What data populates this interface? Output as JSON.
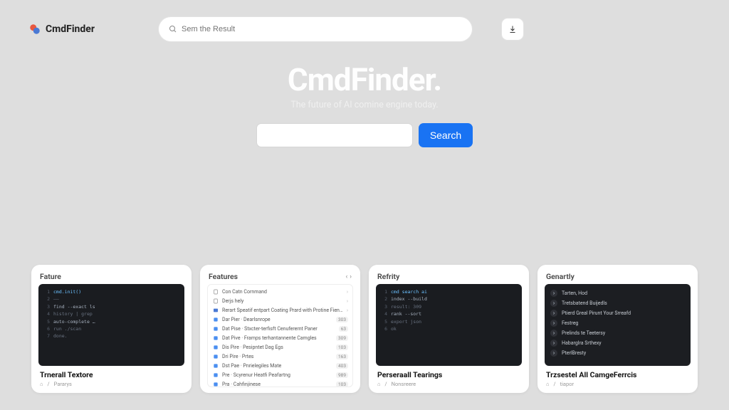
{
  "brand": "CmdFinder",
  "header": {
    "search_placeholder": "Sem the Result"
  },
  "hero": {
    "title": "CmdFinder",
    "dot": ".",
    "subtitle": "The future of AI comine engine today.",
    "search_label": "Search"
  },
  "cards": [
    {
      "head": "Fature",
      "caption": "Trnerall Textore",
      "footer": [
        "⌂",
        "/",
        "Pararys"
      ],
      "term_lines": [
        {
          "n": "1",
          "t": "cmd.init()",
          "cls": "kw"
        },
        {
          "n": "2",
          "t": "——",
          "cls": "dim"
        },
        {
          "n": "3",
          "t": "find --exact ls",
          "cls": ""
        },
        {
          "n": "4",
          "t": "history | grep",
          "cls": "dim"
        },
        {
          "n": "5",
          "t": "auto-complete …",
          "cls": ""
        },
        {
          "n": "6",
          "t": "run ./scan",
          "cls": "dim"
        },
        {
          "n": "7",
          "t": "done.",
          "cls": "dim"
        }
      ]
    },
    {
      "head": "Features",
      "rows": [
        {
          "ico": "doc",
          "txt": "Con Catn Cornmand",
          "chev": true
        },
        {
          "ico": "doc",
          "txt": "Derjs hely",
          "chev": true
        },
        {
          "ico": "img",
          "txt": "Rerart Speatif entpart Coating Prard with Protine Fieneis",
          "chev": true
        },
        {
          "ico": "blue",
          "txt": "Dar Pier · Dearlsnrope",
          "badge": "303"
        },
        {
          "ico": "blue",
          "txt": "Dat Pise · Stxcter-terfisft Cenuferernt Paner",
          "badge": "63"
        },
        {
          "ico": "blue",
          "txt": "Dat Pive · Framps terhantannente Camgles",
          "badge": "309"
        },
        {
          "ico": "blue",
          "txt": "Dis Pire · Pesipntet Dag Egs",
          "badge": "103"
        },
        {
          "ico": "blue",
          "txt": "Dri Pire · Prtes",
          "badge": "163"
        },
        {
          "ico": "blue",
          "txt": "Dst Pae · Pnrielegiles Mate",
          "badge": "403"
        },
        {
          "ico": "blue",
          "txt": "Pre · Scyrenur Heatfi Peafartng",
          "badge": "989"
        },
        {
          "ico": "blue",
          "txt": "Pra · Cahfinjinese",
          "badge": "103"
        }
      ]
    },
    {
      "head": "Refrity",
      "caption": "Perseraall Tearings",
      "footer": [
        "⌂",
        "/",
        "Nonsreere"
      ],
      "term_lines": [
        {
          "n": "1",
          "t": "cmd search ai",
          "cls": "kw"
        },
        {
          "n": "2",
          "t": "index --build",
          "cls": ""
        },
        {
          "n": "3",
          "t": "result: 309",
          "cls": "dim"
        },
        {
          "n": "4",
          "t": "rank --sort",
          "cls": ""
        },
        {
          "n": "5",
          "t": "export json",
          "cls": "dim"
        },
        {
          "n": "6",
          "t": "ok",
          "cls": "dim"
        }
      ]
    },
    {
      "head": "Genartly",
      "caption": "Trzsestel All CamgeFerrcis",
      "footer": [
        "⌂",
        "/",
        "tiapor"
      ],
      "dark_rows": [
        "Tarten, Hod",
        "Tretsbatend Buijedls",
        "Ptierd Greal Pirunt Your Srreafd",
        "Festreg",
        "Prelinds te Teetersy",
        "Habarglra Srthexy",
        "PterlBresty"
      ]
    }
  ]
}
